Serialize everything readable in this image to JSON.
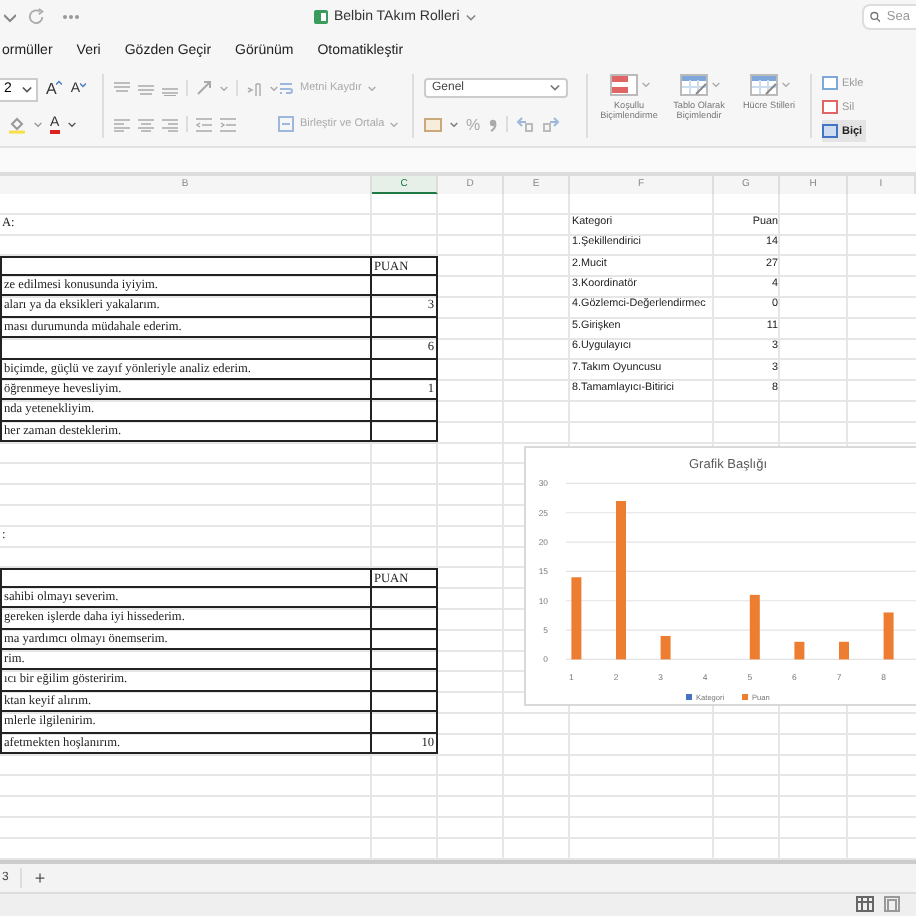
{
  "window": {
    "title": "Belbin TAkım Rolleri",
    "search": {
      "placeholder": "Sea"
    }
  },
  "menu": [
    "ormüller",
    "Veri",
    "Gözden Geçir",
    "Görünüm",
    "Otomatikleştir"
  ],
  "ribbon": {
    "font": {
      "size": "2",
      "grow_glyph": "A",
      "shrink_glyph": "A",
      "color_glyph": "A"
    },
    "wrap_text": {
      "label": "Metni Kaydır",
      "disabled": true
    },
    "merge": {
      "label": "Birleştir ve Ortala",
      "disabled": true
    },
    "number_format": "Genel",
    "percent": "%",
    "styles": [
      {
        "kind": "conditional",
        "label": "Koşullu Biçimlendirme"
      },
      {
        "kind": "table",
        "label": "Tablo Olarak Biçimlendir"
      },
      {
        "kind": "cell",
        "label": "Hücre Stilleri"
      }
    ],
    "cells": [
      {
        "kind": "insert",
        "label": "Ekle"
      },
      {
        "kind": "delete",
        "label": "Sil"
      },
      {
        "kind": "format",
        "label": "Biçi"
      }
    ]
  },
  "sheet": {
    "columns": [
      {
        "label": "B",
        "selected": false
      },
      {
        "label": "C",
        "selected": true
      },
      {
        "label": "D",
        "selected": false
      },
      {
        "label": "E",
        "selected": false
      },
      {
        "label": "F",
        "selected": false
      },
      {
        "label": "G",
        "selected": false
      },
      {
        "label": "H",
        "selected": false
      },
      {
        "label": "I",
        "selected": false
      }
    ],
    "rows": [
      {},
      {
        "b": "A:",
        "f": "Kategori",
        "g": "Puan"
      },
      {
        "f": "1.Şekillendirici",
        "g": "14"
      },
      {
        "c": "PUAN",
        "boxed": true,
        "f": "2.Mucit",
        "g": "27"
      },
      {
        "b": "ze edilmesi konusunda iyiyim.",
        "boxed": true,
        "f": "3.Koordinatör",
        "g": "4"
      },
      {
        "b": "aları ya da eksikleri yakalarım.",
        "c": "3",
        "boxed": true,
        "f": "4.Gözlemci-Değerlendirmec",
        "g": "0"
      },
      {
        "b": "ması durumunda müdahale ederim.",
        "boxed": true,
        "f": "5.Girişken",
        "g": "11"
      },
      {
        "c": "6",
        "boxed": true,
        "f": "6.Uygulayıcı",
        "g": "3"
      },
      {
        "b": "biçimde, güçlü ve zayıf yönleriyle analiz ederim.",
        "boxed": true,
        "f": "7.Takım Oyuncusu",
        "g": "3"
      },
      {
        "b": "öğrenmeye hevesliyim.",
        "c": "1",
        "boxed": true,
        "f": "8.Tamamlayıcı-Bitirici",
        "g": "8"
      },
      {
        "b": "nda yetenekliyim.",
        "boxed": true
      },
      {
        "b": "her zaman desteklerim.",
        "boxed": true
      },
      {},
      {},
      {},
      {},
      {
        "b": ":"
      },
      {},
      {
        "c": "PUAN",
        "boxed": true
      },
      {
        "b": "sahibi olmayı severim.",
        "boxed": true
      },
      {
        "b": "gereken işlerde daha iyi hissederim.",
        "boxed": true
      },
      {
        "b": "ma yardımcı olmayı önemserim.",
        "boxed": true
      },
      {
        "b": "rim.",
        "boxed": true
      },
      {
        "b": "ıcı bir eğilim gösteririm.",
        "boxed": true
      },
      {
        "b": "ktan keyif alırım.",
        "boxed": true
      },
      {
        "b": "mlerle ilgilenirim.",
        "boxed": true
      },
      {
        "b": "afetmekten hoşlanırım.",
        "c": "10",
        "boxed": true
      },
      {},
      {},
      {},
      {},
      {}
    ]
  },
  "chart": {
    "chart_data": {
      "type": "bar",
      "title": "Grafik Başlığı",
      "categories": [
        "1",
        "2",
        "3",
        "4",
        "5",
        "6",
        "7",
        "8"
      ],
      "series": [
        {
          "name": "Kategori",
          "color": "#4472c4",
          "values": [
            null,
            null,
            null,
            null,
            null,
            null,
            null,
            null
          ]
        },
        {
          "name": "Puan",
          "color": "#ed7d31",
          "values": [
            14,
            27,
            4,
            0,
            11,
            3,
            3,
            8
          ]
        }
      ],
      "grid": true,
      "ylim": [
        0,
        30
      ],
      "yticks": [
        0,
        5,
        10,
        15,
        20,
        25,
        30
      ]
    }
  },
  "sheet_tabs": [
    {
      "label": "3"
    }
  ],
  "add_sheet": "+"
}
